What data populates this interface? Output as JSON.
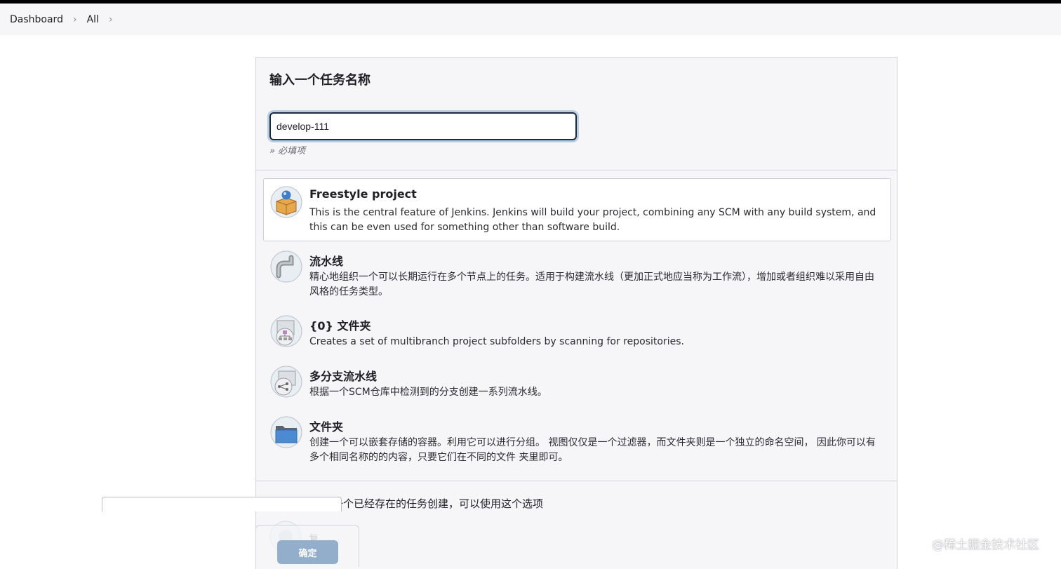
{
  "breadcrumb": {
    "items": [
      "Dashboard",
      "All"
    ],
    "separator": "›"
  },
  "form": {
    "title": "输入一个任务名称",
    "item_name_value": "develop-111",
    "required_hint": "» 必填项"
  },
  "item_types": [
    {
      "icon": "freestyle-project-icon",
      "title": "Freestyle project",
      "description": "This is the central feature of Jenkins. Jenkins will build your project, combining any SCM with any build system, and this can be even used for something other than software build.",
      "selected": true
    },
    {
      "icon": "pipeline-icon",
      "title": "流水线",
      "description": "精心地组织一个可以长期运行在多个节点上的任务。适用于构建流水线（更加正式地应当称为工作流），增加或者组织难以采用自由风格的任务类型。",
      "selected": false
    },
    {
      "icon": "organization-folder-icon",
      "title": "{0} 文件夹",
      "description": "Creates a set of multibranch project subfolders by scanning for repositories.",
      "selected": false
    },
    {
      "icon": "multibranch-pipeline-icon",
      "title": "多分支流水线",
      "description": "根据一个SCM仓库中检测到的分支创建一系列流水线。",
      "selected": false
    },
    {
      "icon": "folder-icon",
      "title": "文件夹",
      "description": "创建一个可以嵌套存储的容器。利用它可以进行分组。 视图仅仅是一个过滤器，而文件夹则是一个独立的命名空间， 因此你可以有多个相同名称的的内容，只要它们在不同的文件 夹里即可。",
      "selected": false
    }
  ],
  "copy_section": {
    "hint": "如果你想根据一个已经存在的任务创建，可以使用这个选项",
    "option_label": "复制"
  },
  "actions": {
    "ok_label": "确定"
  },
  "watermark": "@稀土掘金技术社区",
  "colors": {
    "panel_bg": "#f6f6f8",
    "input_focus": "#b6cfe5",
    "ok_button": "#93aeca"
  }
}
